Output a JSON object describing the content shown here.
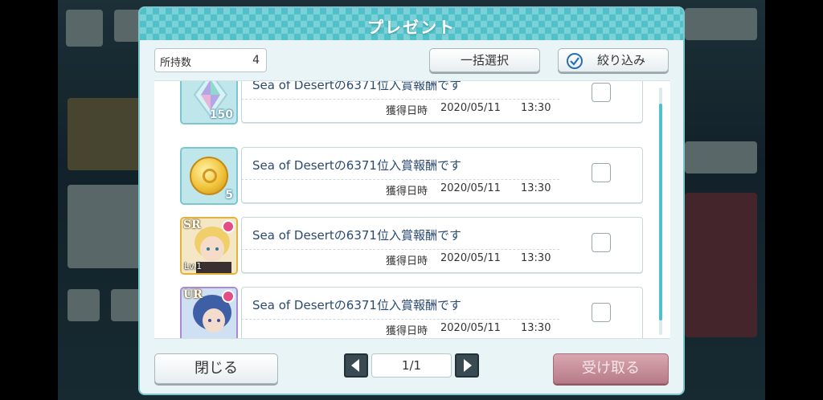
{
  "modal": {
    "title": "プレゼント"
  },
  "inventory": {
    "label": "所持数",
    "count": "4"
  },
  "buttons": {
    "select_all": "一括選択",
    "filter": "絞り込み",
    "close": "閉じる",
    "receive": "受け取る"
  },
  "pager": {
    "page": "1/1"
  },
  "items": [
    {
      "title": "Sea of Desertの6371位入賞報酬です",
      "date_label": "獲得日時",
      "date": "2020/05/11",
      "time": "13:30",
      "icon": "crystal-icon",
      "qty": "150"
    },
    {
      "title": "Sea of Desertの6371位入賞報酬です",
      "date_label": "獲得日時",
      "date": "2020/05/11",
      "time": "13:30",
      "icon": "coin-icon",
      "qty": "5"
    },
    {
      "title": "Sea of Desertの6371位入賞報酬です",
      "date_label": "獲得日時",
      "date": "2020/05/11",
      "time": "13:30",
      "icon": "card-portrait",
      "rarity": "SR",
      "level": "Lv.1"
    },
    {
      "title": "Sea of Desertの6371位入賞報酬です",
      "date_label": "獲得日時",
      "date": "2020/05/11",
      "time": "13:30",
      "icon": "card-portrait",
      "rarity": "UR"
    }
  ],
  "colors": {
    "header": "#50c0c9",
    "receive_button": "#b77b86",
    "title_text": "#2a4a70"
  }
}
